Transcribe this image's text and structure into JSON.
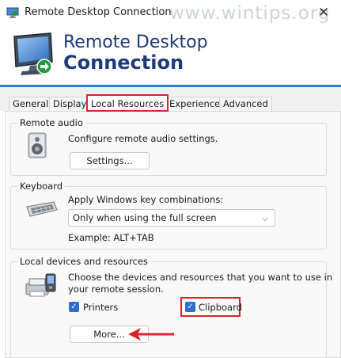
{
  "window": {
    "title": "Remote Desktop Connection",
    "watermark": "www.wintips.org",
    "close_glyph": "✕"
  },
  "banner": {
    "line1": "Remote Desktop",
    "line2": "Connection"
  },
  "tabs": [
    {
      "label": "General"
    },
    {
      "label": "Display"
    },
    {
      "label": "Local Resources",
      "active": true
    },
    {
      "label": "Experience"
    },
    {
      "label": "Advanced"
    }
  ],
  "remote_audio": {
    "legend": "Remote audio",
    "description": "Configure remote audio settings.",
    "settings_button": "Settings...",
    "icon": "speaker-icon"
  },
  "keyboard": {
    "legend": "Keyboard",
    "description": "Apply Windows key combinations:",
    "selected_option": "Only when using the full screen",
    "example": "Example: ALT+TAB",
    "icon": "keyboard-icon"
  },
  "local_devices": {
    "legend": "Local devices and resources",
    "description_line1": "Choose the devices and resources that you want to use in",
    "description_line2": "your remote session.",
    "printers_label": "Printers",
    "printers_checked": true,
    "clipboard_label": "Clipboard",
    "clipboard_checked": true,
    "more_button": "More...",
    "icon": "devices-icon"
  },
  "colors": {
    "accent": "#2a6fc9",
    "highlight": "#d9252e",
    "banner_text": "#1e3a7b",
    "banner_line": "#2b7dcd"
  }
}
